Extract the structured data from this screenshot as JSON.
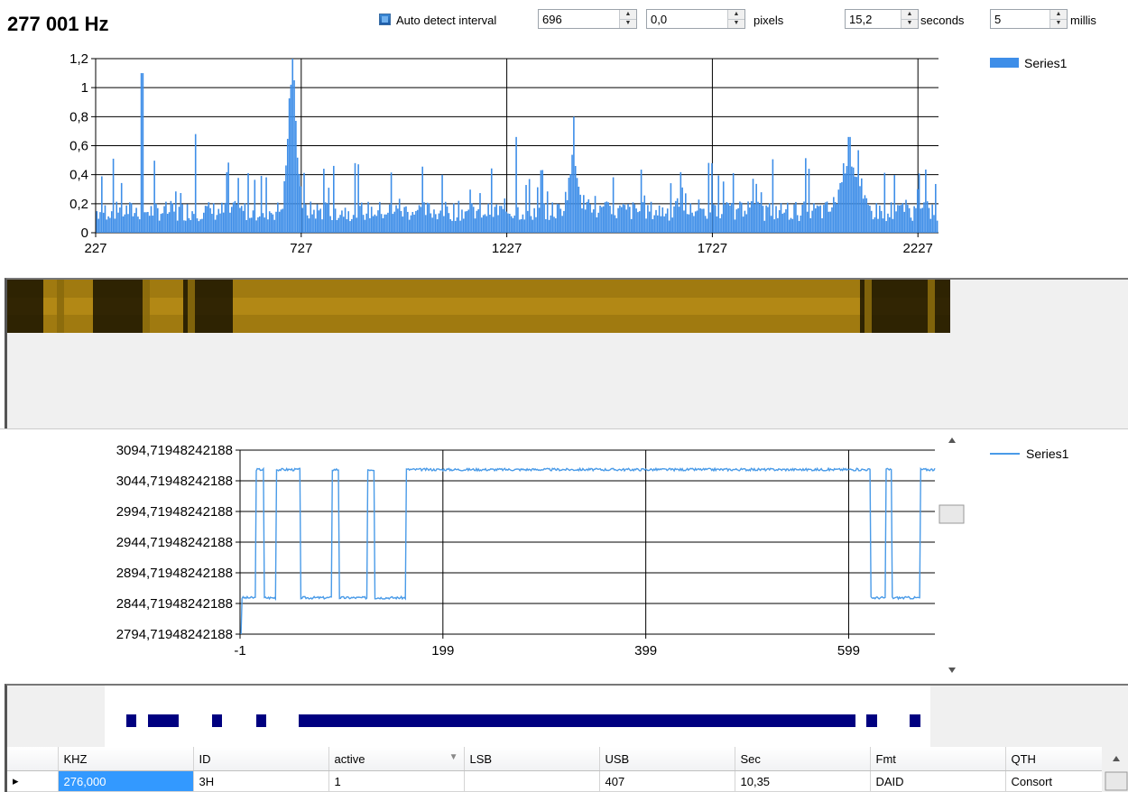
{
  "toolbar": {
    "frequency": "277 001 Hz",
    "auto_detect_label": "Auto detect interval",
    "auto_detect_checked": true,
    "interval_value": "696",
    "offset_value": "0,0",
    "pixels_label": "pixels",
    "seconds_value": "15,2",
    "seconds_label": "seconds",
    "millis_value": "5",
    "millis_label": "millis"
  },
  "colors": {
    "series_blue": "#3e8ee8",
    "waterfall_gold": "#a07a10",
    "bit_navy": "#000080"
  },
  "spectrum_chart": {
    "chart_data": {
      "type": "bar",
      "x_ticks": [
        "227",
        "727",
        "1227",
        "1727",
        "2227"
      ],
      "x_range": [
        227,
        2277
      ],
      "y_ticks": [
        "0",
        "0,2",
        "0,4",
        "0,6",
        "0,8",
        "1",
        "1,2"
      ],
      "ylim": [
        0,
        1.2
      ],
      "legend": [
        "Series1"
      ],
      "legend_position": "top-right",
      "grid": true,
      "peaks": [
        {
          "x": 340,
          "y": 1.1
        },
        {
          "x": 470,
          "y": 0.68
        },
        {
          "x": 705,
          "y": 1.18
        },
        {
          "x": 1250,
          "y": 0.66
        },
        {
          "x": 1390,
          "y": 0.8
        },
        {
          "x": 2060,
          "y": 0.66
        },
        {
          "x": 2227,
          "y": 0.3
        }
      ],
      "baseline": 0.2
    }
  },
  "waterfall": {
    "dark_bands": [
      "0-40",
      "95-150",
      "195-250",
      "945-1045"
    ]
  },
  "time_chart": {
    "chart_data": {
      "type": "line",
      "x_ticks": [
        "-1",
        "199",
        "399",
        "599"
      ],
      "x_range": [
        -1,
        684
      ],
      "y_ticks": [
        "2794,71948242188",
        "2844,71948242188",
        "2894,71948242188",
        "2944,71948242188",
        "2994,71948242188",
        "3044,71948242188",
        "3094,71948242188"
      ],
      "ylim": [
        2794.71948242188,
        3094.71948242188
      ],
      "high": 3063,
      "low": 2854,
      "high_intervals": [
        [
          15,
          22
        ],
        [
          35,
          58
        ],
        [
          90,
          96
        ],
        [
          125,
          131
        ],
        [
          163,
          620
        ],
        [
          636,
          641
        ],
        [
          670,
          684
        ]
      ],
      "legend": [
        "Series1"
      ],
      "legend_position": "top-right",
      "grid": true
    }
  },
  "bits": {
    "segments": [
      [
        137,
        148
      ],
      [
        161,
        195
      ],
      [
        232,
        243
      ],
      [
        281,
        292
      ],
      [
        328,
        945
      ],
      [
        957,
        969
      ],
      [
        1005,
        1017
      ]
    ]
  },
  "grid": {
    "columns": [
      "",
      "KHZ",
      "ID",
      "active",
      "LSB",
      "USB",
      "Sec",
      "Fmt",
      "QTH"
    ],
    "sort_indicator": "active",
    "rows": [
      [
        "▸",
        "276,000",
        "3H",
        "1",
        "",
        "407",
        "10,35",
        "DAID",
        "Consort"
      ]
    ]
  }
}
